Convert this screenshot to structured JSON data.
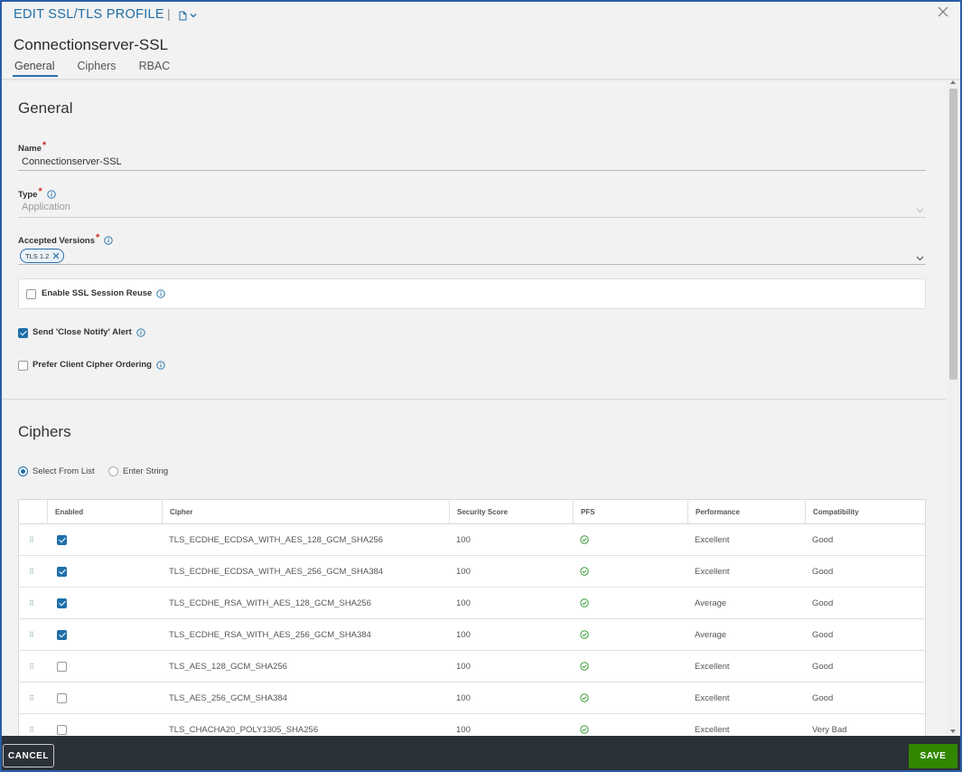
{
  "dialog": {
    "title": "EDIT SSL/TLS PROFILE",
    "separator": "|",
    "profile_name": "Connectionserver-SSL"
  },
  "tabs": [
    {
      "label": "General",
      "active": true
    },
    {
      "label": "Ciphers",
      "active": false
    },
    {
      "label": "RBAC",
      "active": false
    }
  ],
  "general": {
    "section_title": "General",
    "name": {
      "label": "Name",
      "required_mark": "*",
      "value": "Connectionserver-SSL"
    },
    "type": {
      "label": "Type",
      "required_mark": "*",
      "value": "Application"
    },
    "accepted_versions": {
      "label": "Accepted Versions",
      "required_mark": "*",
      "tags": [
        "TLS 1.2"
      ]
    },
    "enable_ssl_session_reuse": {
      "label": "Enable SSL Session Reuse",
      "checked": false
    },
    "send_close_notify": {
      "label": "Send 'Close Notify' Alert",
      "checked": true
    },
    "prefer_client_cipher_ordering": {
      "label": "Prefer Client Cipher Ordering",
      "checked": false
    }
  },
  "ciphers": {
    "section_title": "Ciphers",
    "mode_options": [
      {
        "label": "Select From List",
        "selected": true
      },
      {
        "label": "Enter String",
        "selected": false
      }
    ],
    "columns": [
      "Enabled",
      "Cipher",
      "Security Score",
      "PFS",
      "Performance",
      "Compatibility"
    ],
    "rows": [
      {
        "enabled": true,
        "cipher": "TLS_ECDHE_ECDSA_WITH_AES_128_GCM_SHA256",
        "score": "100",
        "pfs": true,
        "performance": "Excellent",
        "compatibility": "Good"
      },
      {
        "enabled": true,
        "cipher": "TLS_ECDHE_ECDSA_WITH_AES_256_GCM_SHA384",
        "score": "100",
        "pfs": true,
        "performance": "Excellent",
        "compatibility": "Good"
      },
      {
        "enabled": true,
        "cipher": "TLS_ECDHE_RSA_WITH_AES_128_GCM_SHA256",
        "score": "100",
        "pfs": true,
        "performance": "Average",
        "compatibility": "Good"
      },
      {
        "enabled": true,
        "cipher": "TLS_ECDHE_RSA_WITH_AES_256_GCM_SHA384",
        "score": "100",
        "pfs": true,
        "performance": "Average",
        "compatibility": "Good"
      },
      {
        "enabled": false,
        "cipher": "TLS_AES_128_GCM_SHA256",
        "score": "100",
        "pfs": true,
        "performance": "Excellent",
        "compatibility": "Good"
      },
      {
        "enabled": false,
        "cipher": "TLS_AES_256_GCM_SHA384",
        "score": "100",
        "pfs": true,
        "performance": "Excellent",
        "compatibility": "Good"
      },
      {
        "enabled": false,
        "cipher": "TLS_CHACHA20_POLY1305_SHA256",
        "score": "100",
        "pfs": true,
        "performance": "Excellent",
        "compatibility": "Very Bad"
      }
    ]
  },
  "footer": {
    "cancel_label": "CANCEL",
    "save_label": "SAVE"
  },
  "colors": {
    "accent": "#1f6fa8",
    "save": "#318700",
    "footer": "#2b3138",
    "pfs_ok": "#3a9a3a",
    "required": "#d0312d"
  }
}
